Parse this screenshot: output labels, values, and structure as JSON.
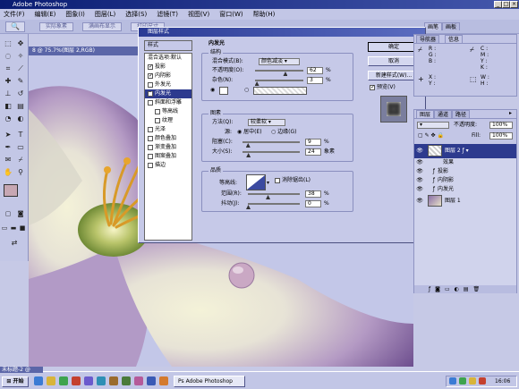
{
  "app": {
    "title": "Adobe Photoshop"
  },
  "menu": [
    "文件(F)",
    "编辑(E)",
    "图象(I)",
    "图层(L)",
    "选择(S)",
    "滤镜(T)",
    "视图(V)",
    "窗口(W)",
    "帮助(H)"
  ],
  "options_bar": {
    "buttons": [
      "实际象素",
      "满画布显示",
      "打印尺寸"
    ],
    "palette_tabs": [
      "画笔",
      "画板"
    ]
  },
  "doc": {
    "title": "8 @ 75.7%(图层 2,RGB)"
  },
  "dialog": {
    "title": "图层样式",
    "styles_header": "样式",
    "blend_options": "混合选项:默认",
    "effects": [
      {
        "label": "投影",
        "checked": true
      },
      {
        "label": "内阴影",
        "checked": true
      },
      {
        "label": "外发光",
        "checked": false
      },
      {
        "label": "内发光",
        "checked": true,
        "selected": true
      },
      {
        "label": "斜面和浮雕",
        "checked": false
      },
      {
        "label": "等高线",
        "checked": false,
        "indent": true
      },
      {
        "label": "纹理",
        "checked": false,
        "indent": true
      },
      {
        "label": "光泽",
        "checked": false
      },
      {
        "label": "颜色叠加",
        "checked": false
      },
      {
        "label": "渐变叠加",
        "checked": false
      },
      {
        "label": "图案叠加",
        "checked": false
      },
      {
        "label": "描边",
        "checked": false
      }
    ],
    "section_title": "内发光",
    "structure": {
      "title": "结构",
      "blend_mode_label": "混合模式(B):",
      "blend_mode_value": "颜色减淡",
      "opacity_label": "不透明度(O):",
      "opacity_value": "62",
      "noise_label": "杂色(N):",
      "noise_value": "3",
      "unit": "%",
      "opacity": 0.62,
      "noise": 0.03
    },
    "elements": {
      "title": "图素",
      "method_label": "方法(Q):",
      "method_value": "较柔软",
      "source_label": "源:",
      "center_label": "居中(E)",
      "edge_label": "边缘(G)",
      "choke_label": "阻塞(C):",
      "choke_value": "9",
      "size_label": "大小(S):",
      "size_value": "24",
      "size_unit": "象素",
      "choke": 0.09,
      "size": 0.096
    },
    "quality": {
      "title": "品质",
      "contour_label": "等高线:",
      "antialias_label": "消除锯齿(L)",
      "range_label": "范围(R):",
      "range_value": "38",
      "jitter_label": "抖动(J):",
      "jitter_value": "0",
      "range": 0.38,
      "jitter": 0
    },
    "buttons": {
      "ok": "确定",
      "cancel": "取消",
      "new_style": "新建样式(W)...",
      "preview": "预览(V)"
    }
  },
  "info_panel": {
    "tabs": [
      "导航器",
      "信息"
    ],
    "rgb": [
      "R :",
      "G :",
      "B :"
    ],
    "cmyk": [
      "C :",
      "M :",
      "Y :",
      "K :"
    ],
    "xy": [
      "X :",
      "Y :"
    ],
    "wh": [
      "W :",
      "H :"
    ]
  },
  "layers_panel": {
    "tabs": [
      "图层",
      "通道",
      "路径"
    ],
    "opacity_label": "不透明度:",
    "opacity_value": "100%",
    "fill_label": "Fill:",
    "fill_value": "100%",
    "layers": [
      {
        "name": "图层 2",
        "type": "layer",
        "selected": true
      },
      {
        "name": "效果",
        "type": "effects"
      },
      {
        "name": "投影",
        "type": "effect"
      },
      {
        "name": "内阴影",
        "type": "effect"
      },
      {
        "name": "内发光",
        "type": "effect"
      },
      {
        "name": "图层 1",
        "type": "layer"
      }
    ]
  },
  "taskbar": {
    "start": "开始",
    "doc_tab": "未标题-2 @",
    "app_btn": "Adobe Photoshop",
    "clock": "16:06"
  },
  "colors": {
    "selection": "#2d3a8e",
    "title_bar": "#0a1c72",
    "fg_swatch": "#c7a7b3",
    "bg_swatch": "#2b1f2a"
  }
}
